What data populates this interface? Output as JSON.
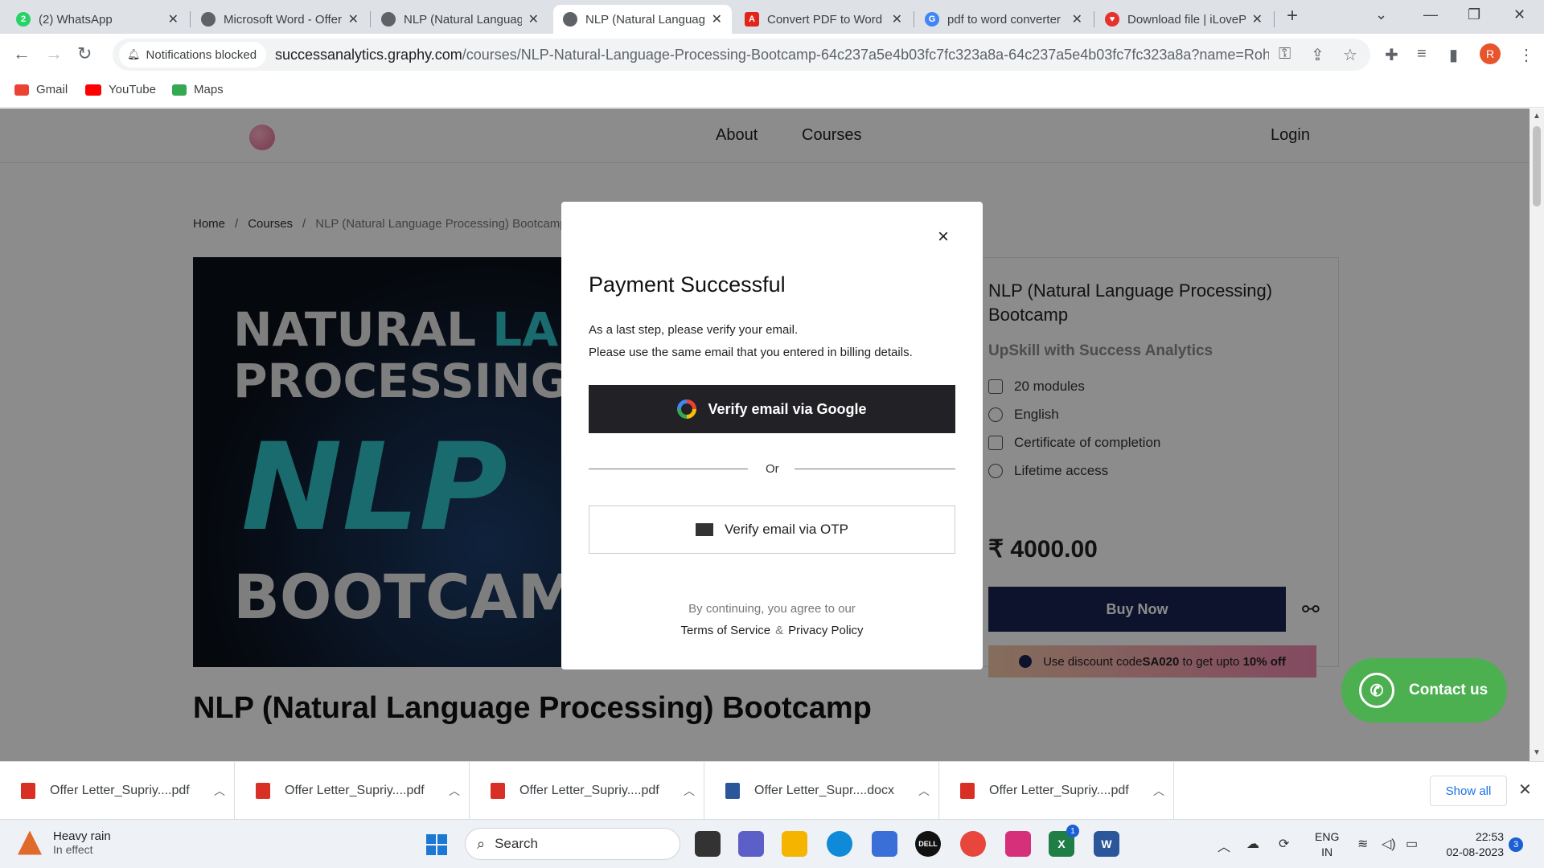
{
  "browser": {
    "tabs": [
      {
        "label": "(2) WhatsApp",
        "favicon": "whatsapp-icon",
        "color": "#25d366",
        "active": false
      },
      {
        "label": "Microsoft Word - Offer",
        "favicon": "globe-icon",
        "color": "#5f6368",
        "active": false
      },
      {
        "label": "NLP (Natural Language",
        "favicon": "globe-icon",
        "color": "#5f6368",
        "active": false
      },
      {
        "label": "NLP (Natural Language",
        "favicon": "globe-icon",
        "color": "#5f6368",
        "active": true
      },
      {
        "label": "Convert PDF to Word",
        "favicon": "adobe-icon",
        "color": "#e0251b",
        "active": false
      },
      {
        "label": "pdf to word converter",
        "favicon": "google-icon",
        "color": "#4285f4",
        "active": false
      },
      {
        "label": "Download file | iLoveP",
        "favicon": "ilovepdf-icon",
        "color": "#e5322d",
        "active": false
      }
    ],
    "new_tab": "+",
    "notification_chip": "Notifications blocked",
    "url_host": "successanalytics.graphy.com",
    "url_path": "/courses/NLP-Natural-Language-Processing-Bootcamp-64c237a5e4b03fc7fc323a8a-64c237a5e4b03fc7fc323a8a?name=Rohit+Ny...",
    "profile_initial": "R",
    "bookmarks": [
      {
        "label": "Gmail",
        "icon": "gmail-icon",
        "color": "#ea4335"
      },
      {
        "label": "YouTube",
        "icon": "youtube-icon",
        "color": "#ff0000"
      },
      {
        "label": "Maps",
        "icon": "maps-icon",
        "color": "#34a853"
      }
    ]
  },
  "site": {
    "nav": {
      "about": "About",
      "courses": "Courses",
      "login": "Login"
    },
    "breadcrumb": {
      "home": "Home",
      "courses": "Courses",
      "current": "NLP (Natural Language Processing) Bootcamp",
      "separator": "/"
    },
    "image_text": {
      "line1a": "NATURAL ",
      "line1b": "LANGUAGE",
      "line2": "PROCESSING",
      "line3": "NLP",
      "line4": "BOOTCAMP"
    },
    "card": {
      "title": "NLP (Natural Language Processing) Bootcamp",
      "subtitle": "UpSkill with Success Analytics",
      "features": [
        {
          "label": "20 modules",
          "icon": "book-icon"
        },
        {
          "label": "English",
          "icon": "globe-icon"
        },
        {
          "label": "Certificate of completion",
          "icon": "certificate-icon"
        },
        {
          "label": "Lifetime access",
          "icon": "clock-icon"
        }
      ],
      "price": "₹ 4000.00",
      "buy_label": "Buy Now",
      "discount_pre": "Use discount code ",
      "discount_code": "SA020",
      "discount_mid": " to get upto ",
      "discount_pct": "10% off"
    },
    "page_title": "NLP (Natural Language Processing) Bootcamp",
    "contact_label": "Contact us"
  },
  "modal": {
    "title": "Payment Successful",
    "line1": "As a last step, please verify your email.",
    "line2": "Please use the same email that you entered in billing details.",
    "google_label": "Verify email via Google",
    "or_label": "Or",
    "otp_label": "Verify email via OTP",
    "agree_text": "By continuing, you agree to our",
    "terms": "Terms of Service",
    "amp": "&",
    "privacy": "Privacy Policy",
    "close": "×"
  },
  "downloads": {
    "items": [
      {
        "name": "Offer Letter_Supriy....pdf",
        "type": "pdf"
      },
      {
        "name": "Offer Letter_Supriy....pdf",
        "type": "pdf"
      },
      {
        "name": "Offer Letter_Supriy....pdf",
        "type": "pdf"
      },
      {
        "name": "Offer Letter_Supr....docx",
        "type": "docx"
      },
      {
        "name": "Offer Letter_Supriy....pdf",
        "type": "pdf"
      }
    ],
    "show_all": "Show all"
  },
  "taskbar": {
    "weather_title": "Heavy rain",
    "weather_sub": "In effect",
    "search_label": "Search",
    "lang_line1": "ENG",
    "lang_line2": "IN",
    "time": "22:53",
    "date": "02-08-2023",
    "notification_count": "3",
    "excel_badge": "1"
  },
  "colors": {
    "buy_button": "#1b2453",
    "google_button": "#222226",
    "contact_button": "#4caf50"
  }
}
